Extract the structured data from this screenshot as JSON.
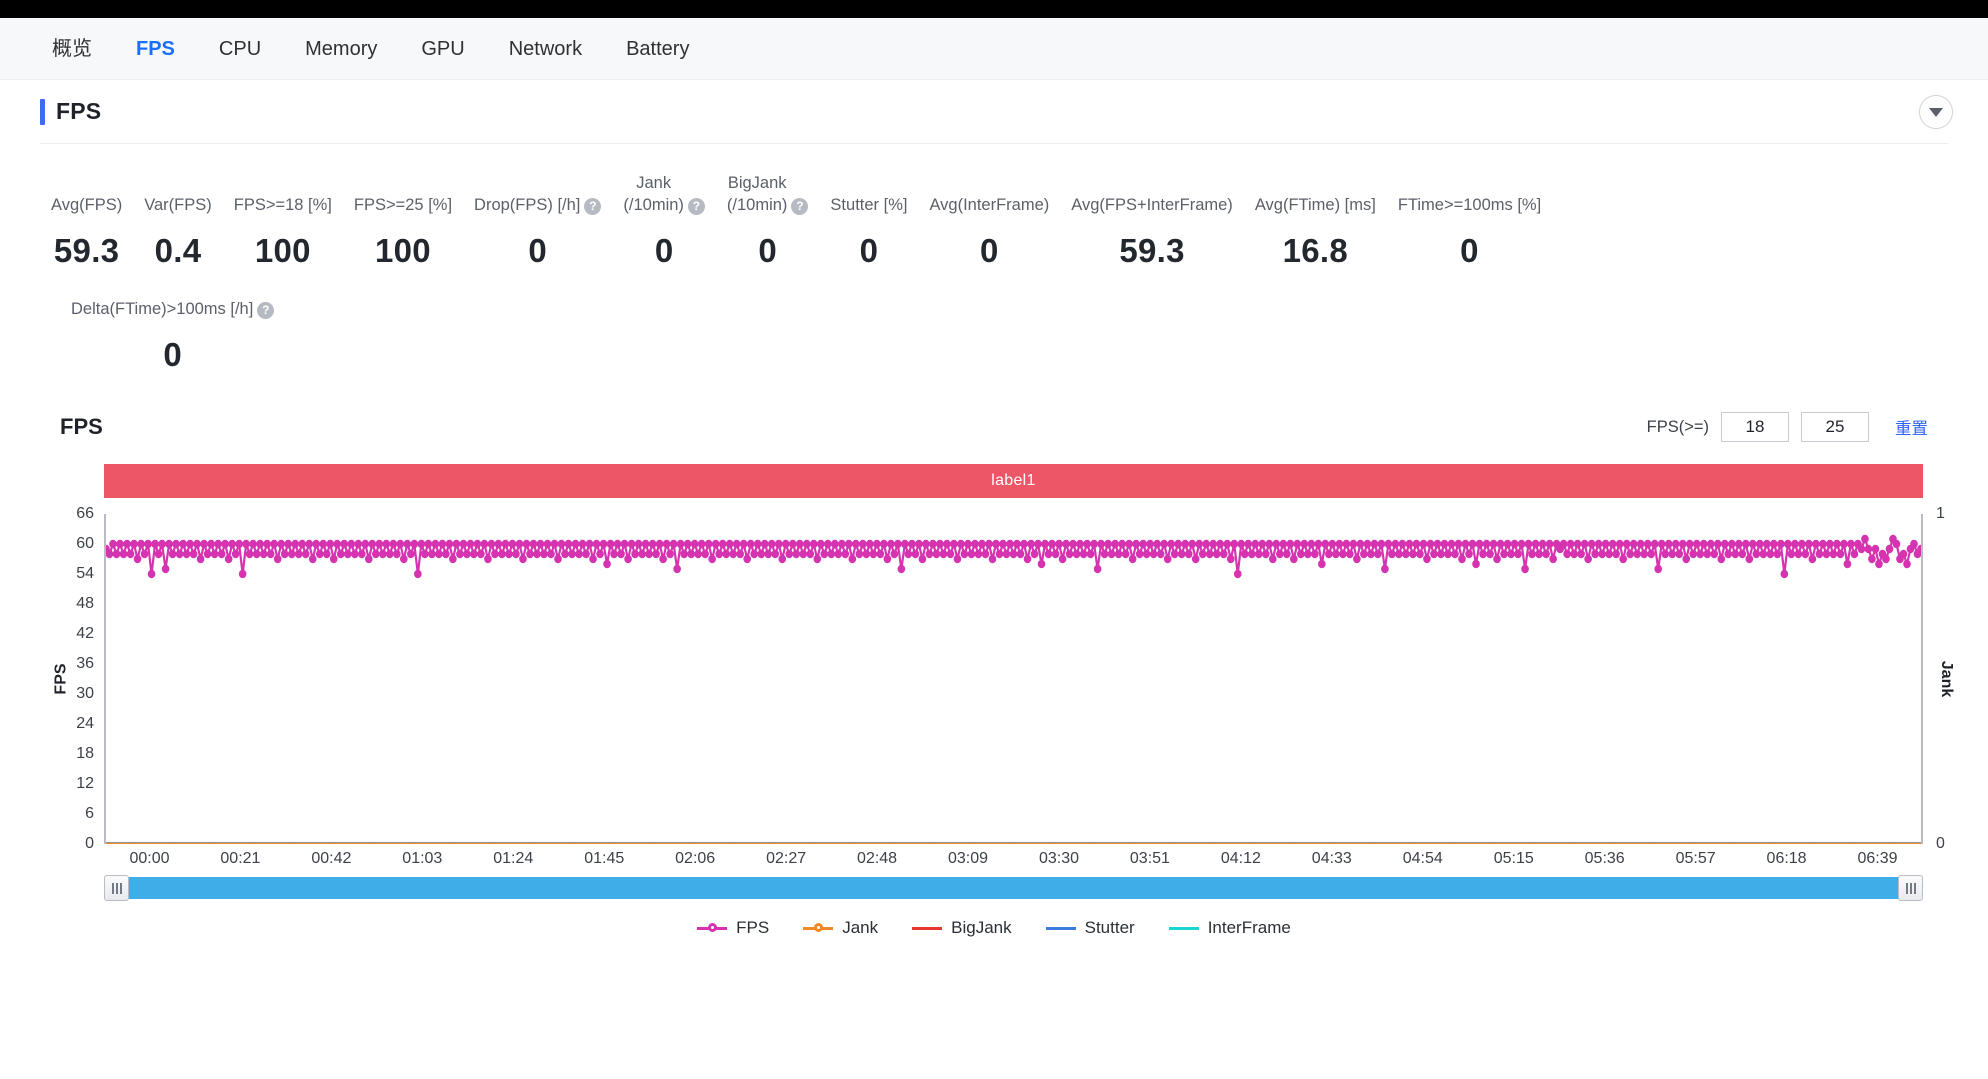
{
  "nav": {
    "tabs": [
      {
        "label": "概览",
        "active": false
      },
      {
        "label": "FPS",
        "active": true
      },
      {
        "label": "CPU",
        "active": false
      },
      {
        "label": "Memory",
        "active": false
      },
      {
        "label": "GPU",
        "active": false
      },
      {
        "label": "Network",
        "active": false
      },
      {
        "label": "Battery",
        "active": false
      }
    ]
  },
  "section": {
    "title": "FPS",
    "collapse_icon": "chevron-down-icon",
    "accent_color": "#3a6df0"
  },
  "metrics": {
    "row1": [
      {
        "label": "Avg(FPS)",
        "value": "59.3",
        "help": false
      },
      {
        "label": "Var(FPS)",
        "value": "0.4",
        "help": false
      },
      {
        "label": "FPS>=18 [%]",
        "value": "100",
        "help": false
      },
      {
        "label": "FPS>=25 [%]",
        "value": "100",
        "help": false
      },
      {
        "label": "Drop(FPS) [/h]",
        "value": "0",
        "help": true
      },
      {
        "label": "Jank\n(/10min)",
        "value": "0",
        "help": true
      },
      {
        "label": "BigJank\n(/10min)",
        "value": "0",
        "help": true
      },
      {
        "label": "Stutter [%]",
        "value": "0",
        "help": false
      },
      {
        "label": "Avg(InterFrame)",
        "value": "0",
        "help": false
      },
      {
        "label": "Avg(FPS+InterFrame)",
        "value": "59.3",
        "help": false
      },
      {
        "label": "Avg(FTime) [ms]",
        "value": "16.8",
        "help": false
      },
      {
        "label": "FTime>=100ms [%]",
        "value": "0",
        "help": false
      }
    ],
    "row2": [
      {
        "label": "Delta(FTime)>100ms [/h]",
        "value": "0",
        "help": true
      }
    ]
  },
  "chart_header": {
    "title": "FPS",
    "fps_ge_label": "FPS(>=)",
    "threshold_low": "18",
    "threshold_high": "25",
    "reset_label": "重置"
  },
  "label_band": {
    "text": "label1",
    "color": "#ec5667"
  },
  "chart_data": {
    "type": "line",
    "title": "FPS",
    "xlabel": "",
    "ylabel": "FPS",
    "y2label": "Jank",
    "ylim": [
      0,
      66
    ],
    "y2lim": [
      0,
      1
    ],
    "grid": false,
    "legend_position": "bottom",
    "yticks": [
      0,
      6,
      12,
      18,
      24,
      30,
      36,
      42,
      48,
      54,
      60,
      66
    ],
    "y2ticks": [
      0,
      1
    ],
    "xticks": [
      "00:00",
      "00:21",
      "00:42",
      "01:03",
      "01:24",
      "01:45",
      "02:06",
      "02:27",
      "02:48",
      "03:09",
      "03:30",
      "03:51",
      "04:12",
      "04:33",
      "04:54",
      "05:15",
      "05:36",
      "05:57",
      "06:18",
      "06:39"
    ],
    "series": [
      {
        "name": "FPS",
        "color": "#d633b0",
        "axis": "left",
        "marker": "circle",
        "summary": {
          "mean": 59.3,
          "min": 54,
          "max": 61,
          "variance": 0.4
        },
        "values": [
          59,
          58,
          60,
          58,
          60,
          58,
          60,
          58,
          60,
          57,
          60,
          58,
          60,
          54,
          60,
          58,
          60,
          55,
          60,
          58,
          60,
          58,
          60,
          58,
          60,
          58,
          60,
          57,
          60,
          58,
          60,
          58,
          60,
          58,
          60,
          57,
          60,
          58,
          60,
          54,
          60,
          58,
          60,
          58,
          60,
          58,
          60,
          58,
          60,
          57,
          60,
          58,
          60,
          58,
          60,
          58,
          60,
          58,
          60,
          57,
          60,
          58,
          60,
          58,
          60,
          57,
          60,
          58,
          60,
          58,
          60,
          58,
          60,
          58,
          60,
          57,
          60,
          58,
          60,
          58,
          60,
          58,
          60,
          58,
          60,
          57,
          60,
          58,
          60,
          54,
          60,
          58,
          60,
          58,
          60,
          58,
          60,
          58,
          60,
          57,
          60,
          58,
          60,
          58,
          60,
          58,
          60,
          58,
          60,
          57,
          60,
          58,
          60,
          58,
          60,
          58,
          60,
          58,
          60,
          57,
          60,
          58,
          60,
          58,
          60,
          58,
          60,
          58,
          60,
          57,
          60,
          58,
          60,
          58,
          60,
          58,
          60,
          58,
          60,
          57,
          60,
          58,
          60,
          56,
          60,
          58,
          60,
          58,
          60,
          57,
          60,
          58,
          60,
          58,
          60,
          58,
          60,
          58,
          60,
          57,
          60,
          58,
          60,
          55,
          60,
          58,
          60,
          58,
          60,
          58,
          60,
          58,
          60,
          57,
          60,
          58,
          60,
          58,
          60,
          58,
          60,
          58,
          60,
          57,
          60,
          58,
          60,
          58,
          60,
          58,
          60,
          58,
          60,
          57,
          60,
          58,
          60,
          58,
          60,
          58,
          60,
          58,
          60,
          57,
          60,
          58,
          60,
          58,
          60,
          58,
          60,
          58,
          60,
          57,
          60,
          58,
          60,
          58,
          60,
          58,
          60,
          58,
          60,
          57,
          60,
          58,
          60,
          55,
          60,
          58,
          60,
          58,
          60,
          57,
          60,
          58,
          60,
          58,
          60,
          58,
          60,
          58,
          60,
          57,
          60,
          58,
          60,
          58,
          60,
          58,
          60,
          58,
          60,
          57,
          60,
          58,
          60,
          58,
          60,
          58,
          60,
          58,
          60,
          57,
          60,
          58,
          60,
          56,
          60,
          58,
          60,
          58,
          60,
          57,
          60,
          58,
          60,
          58,
          60,
          58,
          60,
          58,
          60,
          55,
          60,
          58,
          60,
          58,
          60,
          58,
          60,
          58,
          60,
          57,
          60,
          58,
          60,
          58,
          60,
          58,
          60,
          58,
          60,
          57,
          60,
          58,
          60,
          58,
          60,
          58,
          60,
          57,
          60,
          58,
          60,
          58,
          60,
          58,
          60,
          58,
          60,
          57,
          60,
          54,
          60,
          58,
          60,
          58,
          60,
          58,
          60,
          58,
          60,
          57,
          60,
          58,
          60,
          58,
          60,
          57,
          60,
          58,
          60,
          58,
          60,
          58,
          60,
          56,
          60,
          58,
          60,
          58,
          60,
          58,
          60,
          58,
          60,
          57,
          60,
          58,
          60,
          58,
          60,
          58,
          60,
          55,
          60,
          58,
          60,
          58,
          60,
          58,
          60,
          58,
          60,
          58,
          60,
          57,
          60,
          58,
          60,
          58,
          60,
          58,
          60,
          58,
          60,
          57,
          60,
          58,
          60,
          56,
          60,
          58,
          60,
          58,
          60,
          57,
          60,
          58,
          60,
          58,
          60,
          58,
          60,
          55,
          60,
          58,
          60,
          58,
          60,
          58,
          60,
          57,
          60,
          59,
          60,
          58,
          60,
          58,
          60,
          58,
          60,
          57,
          60,
          58,
          60,
          58,
          60,
          58,
          60,
          58,
          60,
          57,
          60,
          58,
          60,
          58,
          60,
          58,
          60,
          58,
          60,
          55,
          60,
          58,
          60,
          58,
          60,
          58,
          60,
          57,
          60,
          58,
          60,
          58,
          60,
          58,
          60,
          58,
          60,
          57,
          60,
          58,
          60,
          58,
          60,
          58,
          60,
          57,
          60,
          58,
          60,
          58,
          60,
          58,
          60,
          58,
          60,
          54,
          60,
          58,
          60,
          58,
          60,
          58,
          60,
          57,
          60,
          58,
          60,
          58,
          60,
          58,
          60,
          58,
          60,
          56,
          60,
          58,
          60,
          59,
          61,
          59,
          57,
          59,
          56,
          58,
          57,
          59,
          61,
          60,
          57,
          58,
          56,
          59,
          60,
          58,
          59
        ]
      },
      {
        "name": "Jank",
        "color": "#f08a24",
        "axis": "right",
        "marker": "circle",
        "constant": 0
      },
      {
        "name": "BigJank",
        "color": "#e8372f",
        "axis": "right",
        "marker": "line",
        "constant": 0
      },
      {
        "name": "Stutter",
        "color": "#3b7ddd",
        "axis": "right",
        "marker": "line",
        "constant": 0
      },
      {
        "name": "InterFrame",
        "color": "#19d5d5",
        "axis": "left",
        "marker": "line",
        "constant": 0
      }
    ]
  },
  "legend": [
    {
      "label": "FPS",
      "color": "#d633b0",
      "marker": true
    },
    {
      "label": "Jank",
      "color": "#f08a24",
      "marker": true
    },
    {
      "label": "BigJank",
      "color": "#e8372f",
      "marker": false
    },
    {
      "label": "Stutter",
      "color": "#3b7ddd",
      "marker": false
    },
    {
      "label": "InterFrame",
      "color": "#19d5d5",
      "marker": false
    }
  ],
  "slider": {
    "left_handle_icon": "drag-handle-icon",
    "right_handle_icon": "drag-handle-icon",
    "track_color": "#3eade8"
  }
}
